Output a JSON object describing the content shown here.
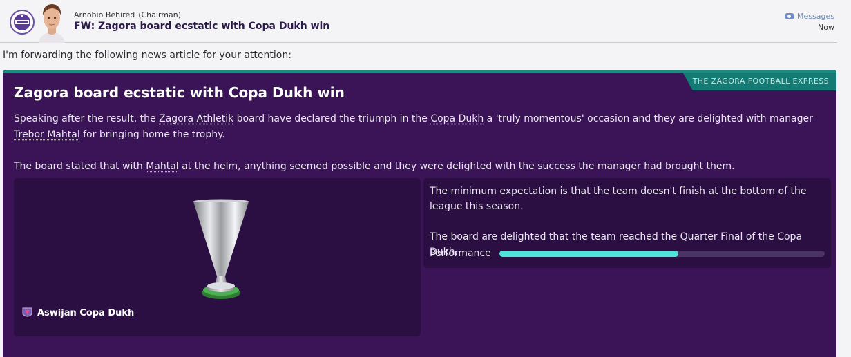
{
  "header": {
    "sender_name": "Arnobio Behired",
    "sender_role": "(Chairman)",
    "subject": "FW: Zagora board ecstatic with Copa Dukh win",
    "messages_link": "Messages",
    "time": "Now"
  },
  "intro": "I'm forwarding the following news article for your attention:",
  "article": {
    "source": "THE ZAGORA FOOTBALL EXPRESS",
    "title": "Zagora board ecstatic with Copa Dukh win",
    "p1": {
      "t1": "Speaking after the result, the ",
      "club": "Zagora Athletik",
      "t2": " board have declared the triumph in the ",
      "competition": "Copa Dukh",
      "t3": " a 'truly momentous' occasion and they are delighted with manager ",
      "manager": "Trebor Mahtal",
      "t4": " for bringing home the trophy."
    },
    "p2": {
      "t1": "The board stated that with ",
      "manager_short": "Mahtal",
      "t2": " at the helm, anything seemed possible and they were delighted with the success the manager had brought them."
    }
  },
  "trophy": {
    "name": "Aswijan Copa Dukh"
  },
  "board_info": {
    "expectation": "The minimum expectation is that the team doesn't finish at the bottom of the league this season.",
    "reaction": "The board are delighted that the team reached the Quarter Final of the Copa Dukh.",
    "performance_label": "Performance",
    "performance_value": 0.55
  },
  "colors": {
    "article_bg": "#3a1456",
    "panel_bg": "#2c0f42",
    "accent_teal": "#147a74",
    "performance_fill": "#4ee5dd"
  },
  "icons": {
    "club_badge": "club-crest-icon",
    "messages": "messages-icon",
    "competition": "competition-crest-icon"
  }
}
